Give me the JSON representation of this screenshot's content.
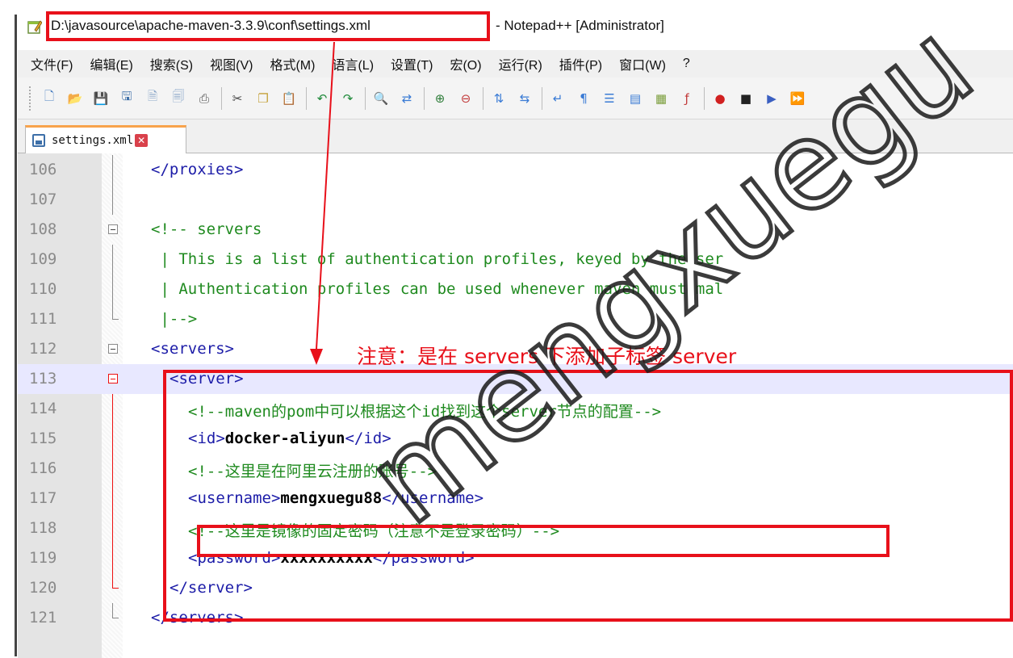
{
  "window": {
    "title_path": "D:\\javasource\\apache-maven-3.3.9\\conf\\settings.xml",
    "title_rest": "- Notepad++ [Administrator]"
  },
  "menu": {
    "items": [
      {
        "label": "文件(F)"
      },
      {
        "label": "编辑(E)"
      },
      {
        "label": "搜索(S)"
      },
      {
        "label": "视图(V)"
      },
      {
        "label": "格式(M)"
      },
      {
        "label": "语言(L)"
      },
      {
        "label": "设置(T)"
      },
      {
        "label": "宏(O)"
      },
      {
        "label": "运行(R)"
      },
      {
        "label": "插件(P)"
      },
      {
        "label": "窗口(W)"
      },
      {
        "label": "?"
      }
    ]
  },
  "toolbar": {
    "groups": [
      [
        {
          "icon": "new-file-icon",
          "glyph": "🗋",
          "color": "#4a7fc1"
        },
        {
          "icon": "open-file-icon",
          "glyph": "📂",
          "color": "#e2a72e"
        },
        {
          "icon": "save-icon",
          "glyph": "💾",
          "color": "#3d6fa8"
        },
        {
          "icon": "save-all-icon",
          "glyph": "🖫",
          "color": "#3d6fa8"
        },
        {
          "icon": "close-file-icon",
          "glyph": "🗎",
          "color": "#8aa7c9"
        },
        {
          "icon": "close-all-icon",
          "glyph": "🗐",
          "color": "#8aa7c9"
        },
        {
          "icon": "print-icon",
          "glyph": "⎙",
          "color": "#555555"
        }
      ],
      [
        {
          "icon": "cut-icon",
          "glyph": "✂",
          "color": "#444444"
        },
        {
          "icon": "copy-icon",
          "glyph": "❐",
          "color": "#c4a13a"
        },
        {
          "icon": "paste-icon",
          "glyph": "📋",
          "color": "#b8862b"
        }
      ],
      [
        {
          "icon": "undo-icon",
          "glyph": "↶",
          "color": "#1f8a3a"
        },
        {
          "icon": "redo-icon",
          "glyph": "↷",
          "color": "#1f8a3a"
        }
      ],
      [
        {
          "icon": "find-icon",
          "glyph": "🔍",
          "color": "#333333"
        },
        {
          "icon": "replace-icon",
          "glyph": "⇄",
          "color": "#3a7bd5"
        }
      ],
      [
        {
          "icon": "zoom-in-icon",
          "glyph": "⊕",
          "color": "#2f7d3a"
        },
        {
          "icon": "zoom-out-icon",
          "glyph": "⊖",
          "color": "#c23b3b"
        }
      ],
      [
        {
          "icon": "sync-vertical-icon",
          "glyph": "⇅",
          "color": "#3a7bd5"
        },
        {
          "icon": "sync-horizontal-icon",
          "glyph": "⇆",
          "color": "#3a7bd5"
        }
      ],
      [
        {
          "icon": "word-wrap-icon",
          "glyph": "↵",
          "color": "#3a7bd5"
        },
        {
          "icon": "show-all-chars-icon",
          "glyph": "¶",
          "color": "#3a7bd5"
        },
        {
          "icon": "indent-guide-icon",
          "glyph": "☰",
          "color": "#3a7bd5"
        },
        {
          "icon": "language-icon",
          "glyph": "▤",
          "color": "#3a7bd5"
        },
        {
          "icon": "document-map-icon",
          "glyph": "▦",
          "color": "#7a9d3a"
        },
        {
          "icon": "function-list-icon",
          "glyph": "ƒ",
          "color": "#c23b3b"
        }
      ],
      [
        {
          "icon": "record-macro-icon",
          "glyph": "●",
          "color": "#d12020"
        },
        {
          "icon": "stop-macro-icon",
          "glyph": "■",
          "color": "#222222"
        },
        {
          "icon": "play-macro-icon",
          "glyph": "▶",
          "color": "#3a5fc1"
        },
        {
          "icon": "run-macro-multiple-icon",
          "glyph": "⏩",
          "color": "#3a5fc1"
        }
      ]
    ]
  },
  "tab": {
    "label": "settings.xml",
    "close_glyph": "✕"
  },
  "editor": {
    "lines": [
      {
        "no": "106",
        "fold": "line",
        "parts": [
          {
            "cls": "tag",
            "t": "</proxies>"
          }
        ],
        "indent": 0
      },
      {
        "no": "107",
        "fold": "line",
        "parts": [],
        "indent": 0
      },
      {
        "no": "108",
        "fold": "box",
        "parts": [
          {
            "cls": "cmt",
            "t": "<!-- servers"
          }
        ],
        "indent": 0
      },
      {
        "no": "109",
        "fold": "line",
        "parts": [
          {
            "cls": "cmt",
            "t": " | This is a list of authentication profiles, keyed by the ser"
          }
        ],
        "indent": 0
      },
      {
        "no": "110",
        "fold": "line",
        "parts": [
          {
            "cls": "cmt",
            "t": " | Authentication profiles can be used whenever maven must mal"
          }
        ],
        "indent": 0
      },
      {
        "no": "111",
        "fold": "tee",
        "parts": [
          {
            "cls": "cmt",
            "t": " |-->"
          }
        ],
        "indent": 0
      },
      {
        "no": "112",
        "fold": "box",
        "parts": [
          {
            "cls": "tag",
            "t": "<servers>"
          }
        ],
        "indent": 0
      },
      {
        "no": "113",
        "fold": "box-red",
        "current": true,
        "parts": [
          {
            "cls": "tag",
            "t": "<server>"
          }
        ],
        "indent": 2
      },
      {
        "no": "114",
        "fold": "line-red",
        "parts": [
          {
            "cls": "cmt",
            "t": "<!--maven的pom中可以根据这个id找到这个server节点的配置-->"
          }
        ],
        "indent": 4
      },
      {
        "no": "115",
        "fold": "line-red",
        "parts": [
          {
            "cls": "tag",
            "t": "<id>"
          },
          {
            "cls": "val",
            "t": "docker-aliyun"
          },
          {
            "cls": "tag",
            "t": "</id>"
          }
        ],
        "indent": 4
      },
      {
        "no": "116",
        "fold": "line-red",
        "parts": [
          {
            "cls": "cmt",
            "t": "<!--这里是在阿里云注册的账号-->"
          }
        ],
        "indent": 4
      },
      {
        "no": "117",
        "fold": "line-red",
        "parts": [
          {
            "cls": "tag",
            "t": "<username>"
          },
          {
            "cls": "val",
            "t": "mengxuegu88"
          },
          {
            "cls": "tag",
            "t": "</username>"
          }
        ],
        "indent": 4
      },
      {
        "no": "118",
        "fold": "line-red",
        "parts": [
          {
            "cls": "cmt",
            "t": "<!--这里是镜像的固定密码（注意不是登录密码）-->"
          }
        ],
        "indent": 4
      },
      {
        "no": "119",
        "fold": "line-red",
        "parts": [
          {
            "cls": "tag",
            "t": "<password>"
          },
          {
            "cls": "val",
            "t": "xxxxxxxxxx"
          },
          {
            "cls": "tag",
            "t": "</password>"
          }
        ],
        "indent": 4
      },
      {
        "no": "120",
        "fold": "tee-red",
        "parts": [
          {
            "cls": "tag",
            "t": "</server>"
          }
        ],
        "indent": 2
      },
      {
        "no": "121",
        "fold": "tee",
        "parts": [
          {
            "cls": "tag",
            "t": "</servers>"
          }
        ],
        "indent": 0
      }
    ]
  },
  "annotation": {
    "note": "注意：是在 servers 下添加子标签 server",
    "color": "#e8101a"
  },
  "watermark": {
    "text": "mengxuegu"
  }
}
